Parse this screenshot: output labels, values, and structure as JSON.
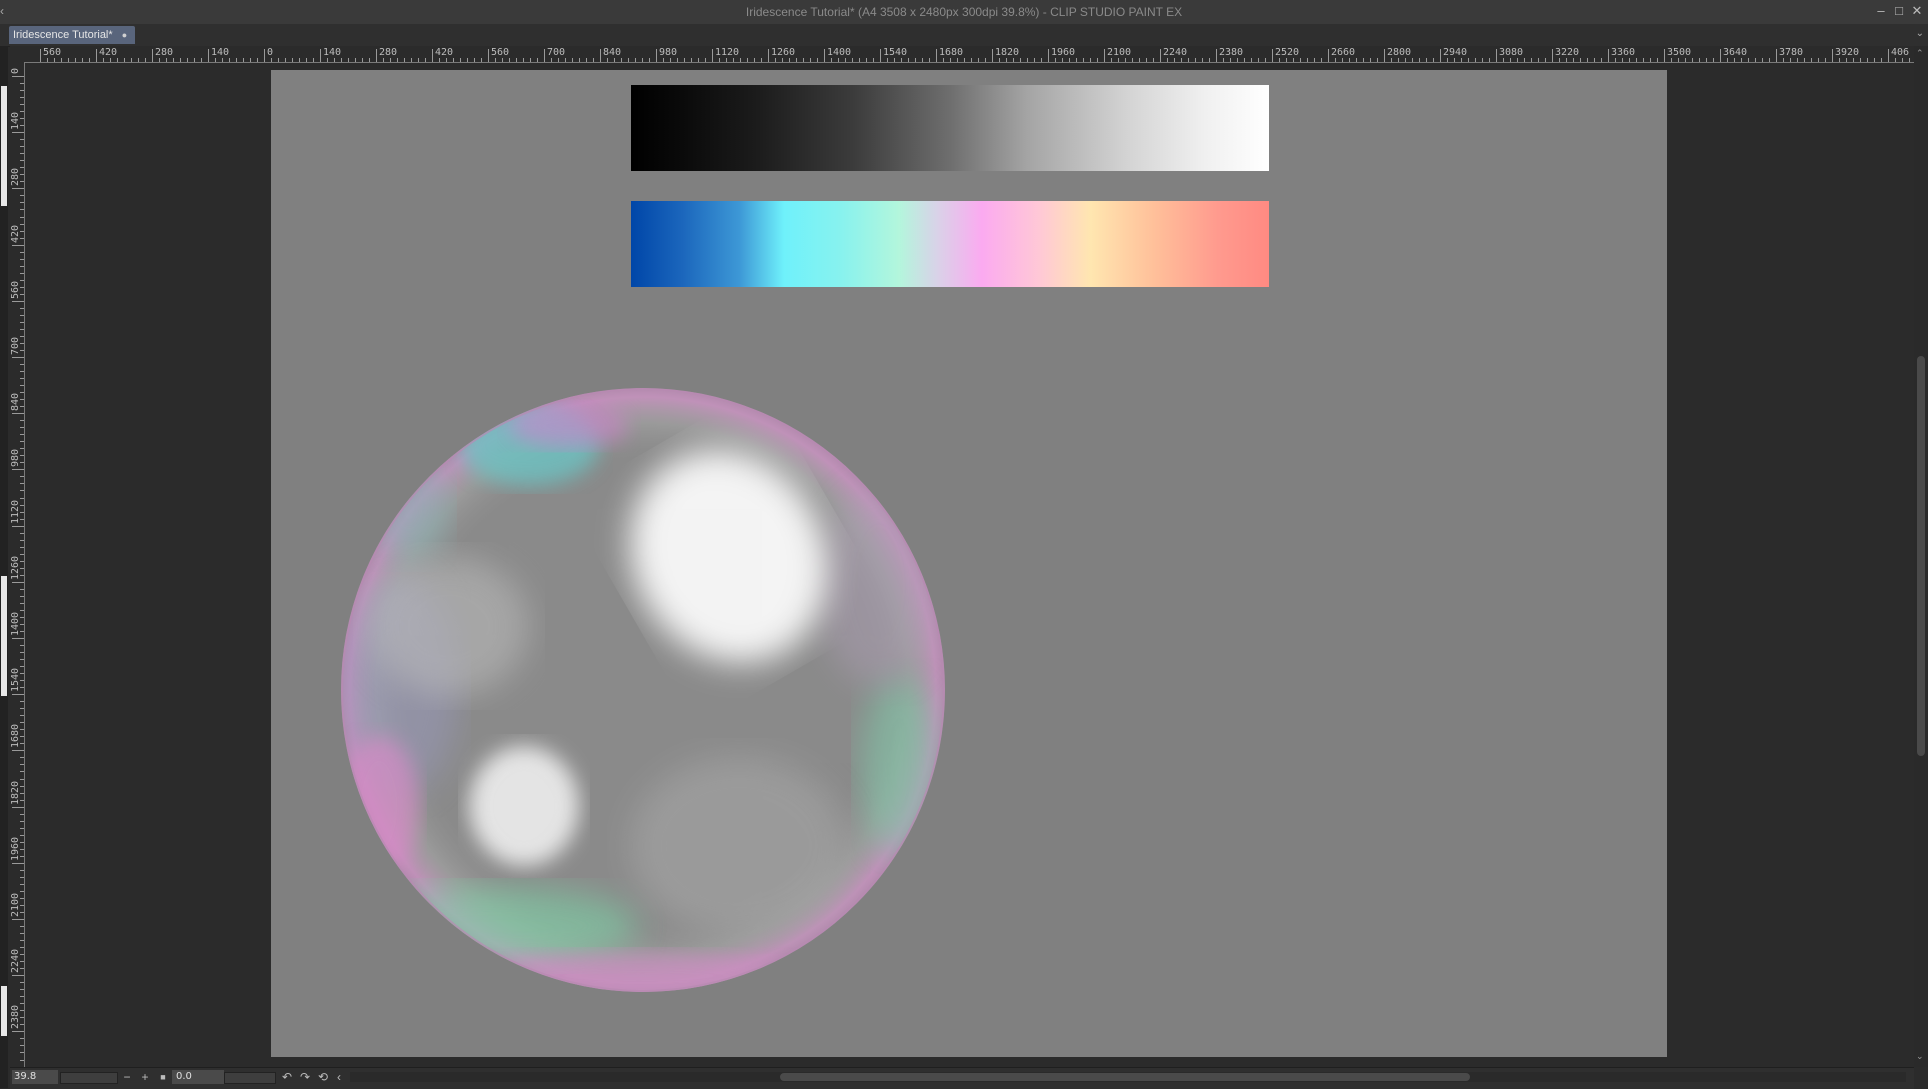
{
  "window": {
    "title": "Iridescence Tutorial* (A4 3508 x 2480px 300dpi 39.8%)  - CLIP STUDIO PAINT EX",
    "minimize_icon": "minimize-icon",
    "maximize_icon": "maximize-icon",
    "close_icon": "close-icon"
  },
  "tabs": [
    {
      "label": "Iridescence Tutorial*",
      "close_glyph": "●"
    }
  ],
  "rulers": {
    "top_labels": [
      "560",
      "420",
      "280",
      "140",
      "0",
      "140",
      "280",
      "420",
      "560",
      "700",
      "840",
      "980",
      "1120",
      "1260",
      "1400",
      "1540",
      "1680",
      "1820",
      "1960",
      "2100",
      "2240",
      "2380",
      "2520",
      "2660",
      "2800",
      "2940",
      "3080",
      "3220",
      "3360",
      "3500",
      "3640",
      "3780",
      "3920",
      "406"
    ],
    "left_labels": [
      "0",
      "140",
      "280",
      "420",
      "560",
      "700",
      "840",
      "980",
      "1120",
      "1260",
      "1400",
      "1540",
      "1680",
      "1820",
      "1960",
      "2100",
      "2240",
      "2380"
    ]
  },
  "canvas": {
    "background": "#808080",
    "grayscale_gradient": [
      "#000000",
      "#ffffff"
    ],
    "iridescent_gradient": [
      "#0046a8",
      "#3d98d6",
      "#6ff1fb",
      "#b3f6dc",
      "#fbaaf0",
      "#ffc8d6",
      "#ffe6b0",
      "#ff8a82"
    ]
  },
  "statusbar": {
    "zoom_value": "39.8",
    "zoom_out_glyph": "−",
    "zoom_in_glyph": "+",
    "fit_glyph": "■",
    "angle_value": "0.0",
    "rotate_left_icon": "rotate-left-icon",
    "rotate_right_icon": "rotate-right-icon",
    "reset_rotation_icon": "reset-rotation-icon",
    "flip_icon": "flip-horizontal-icon"
  }
}
